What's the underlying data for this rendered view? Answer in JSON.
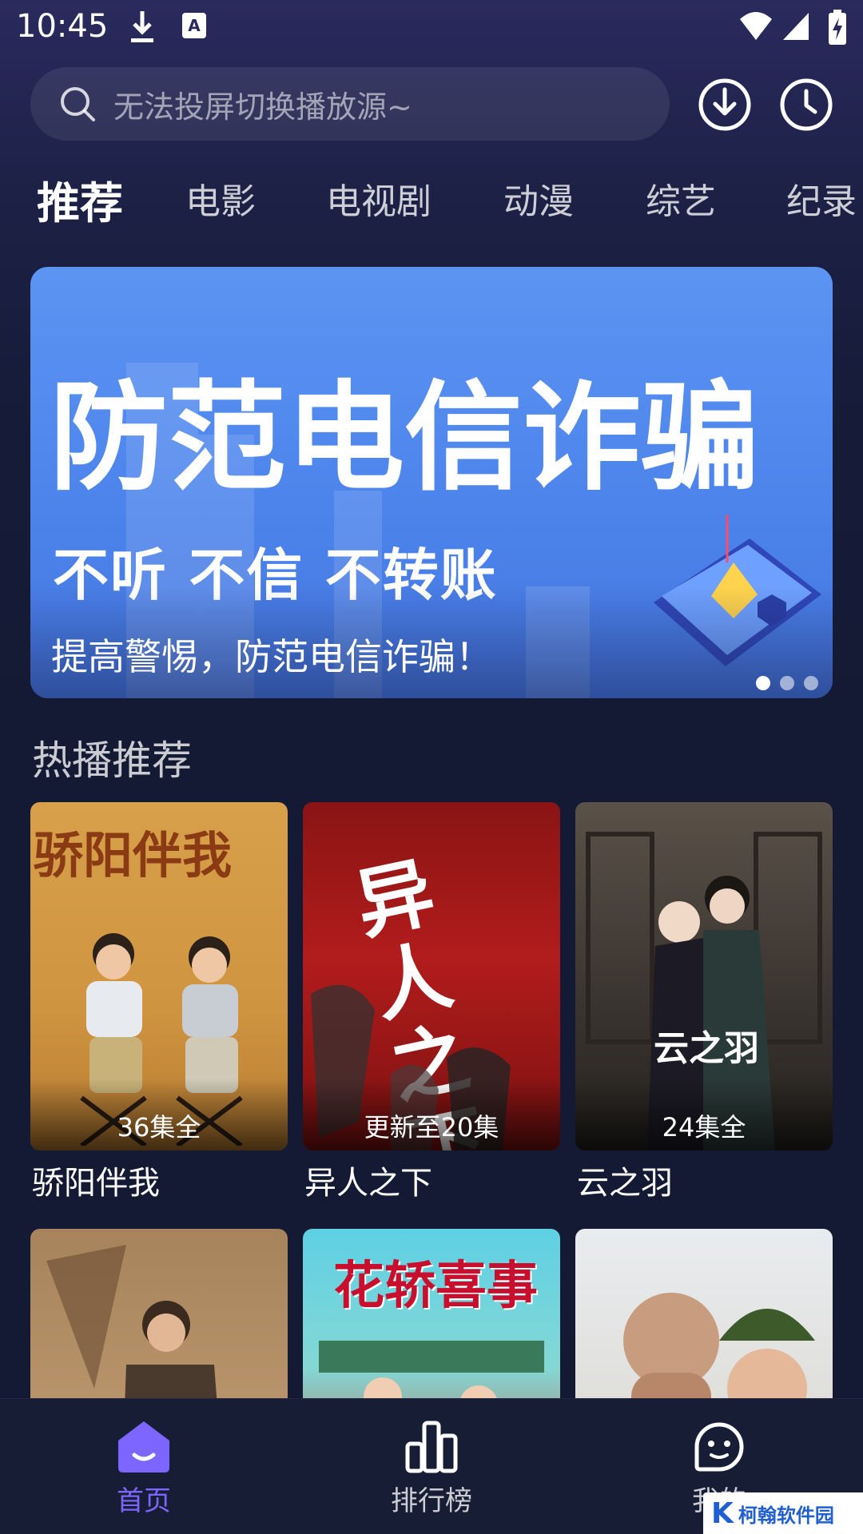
{
  "status_bar": {
    "time": "10:45"
  },
  "search": {
    "placeholder": "无法投屏切换播放源~"
  },
  "tabs": [
    {
      "label": "推荐",
      "active": true
    },
    {
      "label": "电影"
    },
    {
      "label": "电视剧"
    },
    {
      "label": "动漫"
    },
    {
      "label": "综艺"
    },
    {
      "label": "纪录"
    }
  ],
  "banner": {
    "headline": "防范电信诈骗",
    "subline": "不听 不信 不转账",
    "caption": "提高警惕，防范电信诈骗！",
    "slide_count": 3,
    "active_slide": 1
  },
  "hot_section": {
    "title": "热播推荐",
    "items": [
      {
        "title": "骄阳伴我",
        "badge": "36集全",
        "poster_text": "骄阳伴我"
      },
      {
        "title": "异人之下",
        "badge": "更新至20集",
        "poster_text": "异人之下"
      },
      {
        "title": "云之羽",
        "badge": "24集全",
        "poster_text": "云之羽"
      },
      {
        "title": "",
        "badge": ""
      },
      {
        "title": "",
        "badge": "",
        "poster_text": "花轿喜事"
      },
      {
        "title": "",
        "badge": ""
      }
    ]
  },
  "bottom_nav": [
    {
      "label": "首页",
      "active": true
    },
    {
      "label": "排行榜"
    },
    {
      "label": "我的"
    }
  ],
  "watermark": {
    "logo": "K",
    "text": "柯翰软件园"
  },
  "colors": {
    "accent": "#7d66ff",
    "banner_blue": "#5c94f2",
    "background": "#141a33"
  }
}
